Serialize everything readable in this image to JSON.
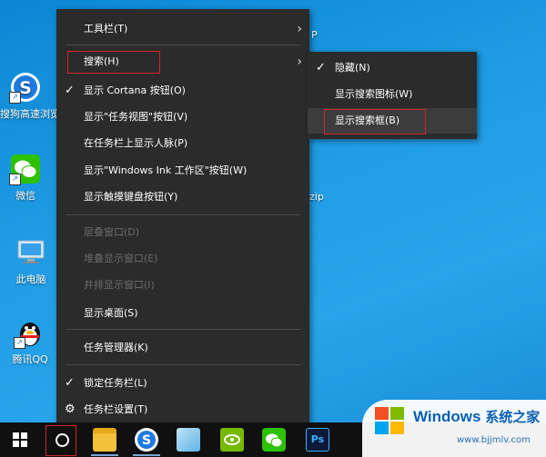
{
  "desktop": {
    "icons": [
      {
        "label": "搜狗高速浏览器",
        "name": "sogou-browser"
      },
      {
        "label": "微信",
        "name": "wechat"
      },
      {
        "label": "此电脑",
        "name": "this-pc"
      },
      {
        "label": "腾讯QQ",
        "name": "tencent-qq"
      }
    ],
    "fragments": {
      "top_right": "P",
      "mid_right": "zip"
    }
  },
  "context_menu": {
    "items": [
      {
        "label": "工具栏(T)",
        "submenu": true
      },
      {
        "label": "搜索(H)",
        "submenu": true,
        "highlighted": true
      },
      {
        "label": "显示 Cortana 按钮(O)",
        "checked": true
      },
      {
        "label": "显示\"任务视图\"按钮(V)"
      },
      {
        "label": "在任务栏上显示人脉(P)"
      },
      {
        "label": "显示\"Windows Ink 工作区\"按钮(W)"
      },
      {
        "label": "显示触摸键盘按钮(Y)"
      },
      {
        "label": "层叠窗口(D)",
        "disabled": true
      },
      {
        "label": "堆叠显示窗口(E)",
        "disabled": true
      },
      {
        "label": "并排显示窗口(I)",
        "disabled": true
      },
      {
        "label": "显示桌面(S)"
      },
      {
        "label": "任务管理器(K)"
      },
      {
        "label": "锁定任务栏(L)",
        "checked": true
      },
      {
        "label": "任务栏设置(T)",
        "icon": "gear-icon"
      }
    ]
  },
  "search_submenu": {
    "items": [
      {
        "label": "隐藏(N)",
        "checked": true
      },
      {
        "label": "显示搜索图标(W)"
      },
      {
        "label": "显示搜索框(B)",
        "highlighted": true
      }
    ]
  },
  "watermark": {
    "title_main": "Windows",
    "title_cn": "系统之家",
    "url": "www.bjjmlv.com"
  },
  "colors": {
    "highlight_border": "#d0262c",
    "menu_bg": "#2b2b2b",
    "desktop_blue": "#1e9be3"
  }
}
